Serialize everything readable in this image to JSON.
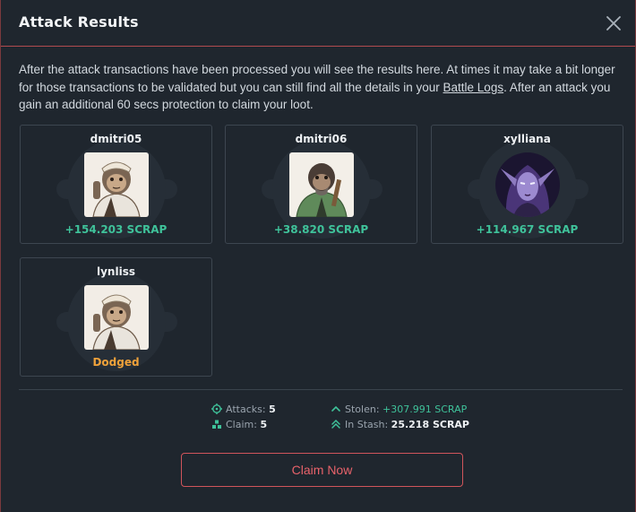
{
  "modal": {
    "title": "Attack Results",
    "intro_before": "After the attack transactions have been processed you will see the results here. At times it may take a bit longer for those transactions to be validated but you can still find all the details in your ",
    "intro_link": "Battle Logs",
    "intro_after": ". After an attack you gain an additional 60 secs protection to claim your loot."
  },
  "results": [
    {
      "name": "dmitri05",
      "result": "+154.203 SCRAP",
      "status": "success",
      "avatar": "ape-icon"
    },
    {
      "name": "dmitri06",
      "result": "+38.820 SCRAP",
      "status": "success",
      "avatar": "ape-icon"
    },
    {
      "name": "xylliana",
      "result": "+114.967 SCRAP",
      "status": "success",
      "avatar": "elf-icon"
    },
    {
      "name": "lynliss",
      "result": "Dodged",
      "status": "dodged",
      "avatar": "ape-icon"
    }
  ],
  "stats": {
    "attacks_label": "Attacks:",
    "attacks_value": "5",
    "claim_label": "Claim:",
    "claim_value": "5",
    "stolen_label": "Stolen:",
    "stolen_value": "+307.991 SCRAP",
    "stash_label": "In Stash:",
    "stash_value": "25.218 SCRAP"
  },
  "claim_button": "Claim Now",
  "colors": {
    "accent": "#d0555b",
    "success": "#3fc29a",
    "dodged": "#f0a23a"
  }
}
